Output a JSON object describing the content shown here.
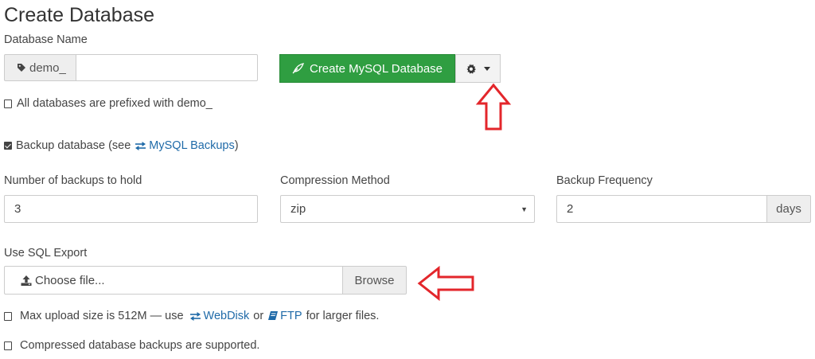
{
  "page": {
    "title": "Create Database"
  },
  "db_name": {
    "label": "Database Name",
    "prefix": "demo_",
    "value": "",
    "create_button_label": "Create MySQL Database",
    "prefix_note": "All databases are prefixed with demo_"
  },
  "backup": {
    "checkbox_text_before": "Backup database (see",
    "link_label": "MySQL Backups",
    "checkbox_text_after": ")",
    "checked": true
  },
  "backups_to_hold": {
    "label": "Number of backups to hold",
    "value": "3"
  },
  "compression": {
    "label": "Compression Method",
    "value": "zip"
  },
  "frequency": {
    "label": "Backup Frequency",
    "value": "2",
    "unit": "days"
  },
  "sql_export": {
    "label": "Use SQL Export",
    "placeholder": "Choose file...",
    "browse_label": "Browse"
  },
  "notes": {
    "upload_before": "Max upload size is 512M — use",
    "webdisk_label": "WebDisk",
    "or_text": "or",
    "ftp_label": "FTP",
    "upload_after": "for larger files.",
    "compressed": "Compressed database backups are supported."
  },
  "colors": {
    "primary_green": "#2f9e41",
    "link_blue": "#1f6aa8",
    "annotation_red": "#e3262b"
  },
  "icons": {
    "prefix": "tag-icon",
    "create": "leaf-icon",
    "options": "gear-icon",
    "backups_link": "exchange-icon",
    "upload": "upload-icon",
    "webdisk": "exchange-icon",
    "ftp": "book-icon"
  }
}
